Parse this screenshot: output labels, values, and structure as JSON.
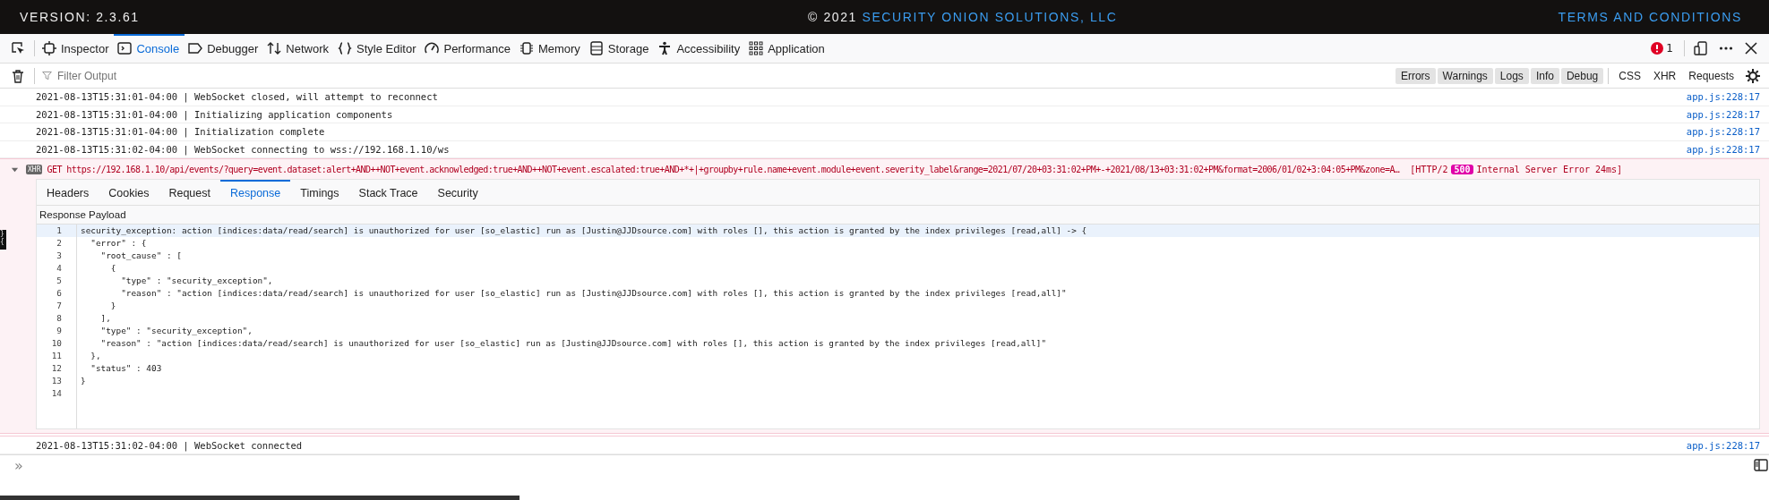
{
  "banner": {
    "version": "VERSION: 2.3.61",
    "copyright": "© 2021",
    "company": "SECURITY ONION SOLUTIONS, LLC",
    "terms": "TERMS AND CONDITIONS"
  },
  "tools": [
    {
      "label": "Inspector",
      "kind": "inspector",
      "selected": false
    },
    {
      "label": "Console",
      "kind": "console",
      "selected": true
    },
    {
      "label": "Debugger",
      "kind": "debugger",
      "selected": false
    },
    {
      "label": "Network",
      "kind": "network",
      "selected": false
    },
    {
      "label": "Style Editor",
      "kind": "style",
      "selected": false
    },
    {
      "label": "Performance",
      "kind": "performance",
      "selected": false
    },
    {
      "label": "Memory",
      "kind": "memory",
      "selected": false
    },
    {
      "label": "Storage",
      "kind": "storage",
      "selected": false
    },
    {
      "label": "Accessibility",
      "kind": "accessibility",
      "selected": false
    },
    {
      "label": "Application",
      "kind": "application",
      "selected": false
    }
  ],
  "error_count": "1",
  "filter": {
    "placeholder": "Filter Output"
  },
  "levels": [
    {
      "label": "Errors",
      "selected": true
    },
    {
      "label": "Warnings",
      "selected": true
    },
    {
      "label": "Logs",
      "selected": true
    },
    {
      "label": "Info",
      "selected": true
    },
    {
      "label": "Debug",
      "selected": true
    }
  ],
  "types": [
    {
      "label": "CSS",
      "selected": false
    },
    {
      "label": "XHR",
      "selected": false
    },
    {
      "label": "Requests",
      "selected": false
    }
  ],
  "messages": [
    {
      "text": "2021-08-13T15:31:01-04:00 | WebSocket closed, will attempt to reconnect",
      "source": "app.js:228:17"
    },
    {
      "text": "2021-08-13T15:31:01-04:00 | Initializing application components",
      "source": "app.js:228:17"
    },
    {
      "text": "2021-08-13T15:31:01-04:00 | Initialization complete",
      "source": "app.js:228:17"
    },
    {
      "text": "2021-08-13T15:31:02-04:00 | WebSocket connecting to wss://192.168.1.10/ws",
      "source": "app.js:228:17"
    }
  ],
  "request": {
    "expanded": true,
    "badge": "XHR",
    "method": "GET",
    "url": "https://192.168.1.10/api/events/?query=event.dataset:alert+AND++NOT+event.acknowledged:true+AND++NOT+event.escalated:true+AND+*+|+groupby+rule.name+event.module+event.severity_label&range=2021/07/20+03:31:02+PM+-+2021/08/13+03:31:02+PM&format=2006/01/02+3:04:05+PM&zone=A…",
    "protocol": "[HTTP/2",
    "status": "500",
    "status_text": "Internal Server Error 24ms]",
    "tabs": [
      {
        "label": "Headers",
        "selected": false
      },
      {
        "label": "Cookies",
        "selected": false
      },
      {
        "label": "Request",
        "selected": false
      },
      {
        "label": "Response",
        "selected": true
      },
      {
        "label": "Timings",
        "selected": false
      },
      {
        "label": "Stack Trace",
        "selected": false
      },
      {
        "label": "Security",
        "selected": false
      }
    ],
    "section": "Response Payload",
    "lines": [
      {
        "number": "1",
        "text": "security_exception: action [indices:data/read/search] is unauthorized for user [so_elastic] run as [Justin@JJDsource.com] with roles [], this action is granted by the index privileges [read,all] -> {",
        "selected": true
      },
      {
        "number": "2",
        "text": "  \"error\" : {",
        "selected": false
      },
      {
        "number": "3",
        "text": "    \"root_cause\" : [",
        "selected": false
      },
      {
        "number": "4",
        "text": "      {",
        "selected": false
      },
      {
        "number": "5",
        "text": "        \"type\" : \"security_exception\",",
        "selected": false
      },
      {
        "number": "6",
        "text": "        \"reason\" : \"action [indices:data/read/search] is unauthorized for user [so_elastic] run as [Justin@JJDsource.com] with roles [], this action is granted by the index privileges [read,all]\"",
        "selected": false
      },
      {
        "number": "7",
        "text": "      }",
        "selected": false
      },
      {
        "number": "8",
        "text": "    ],",
        "selected": false
      },
      {
        "number": "9",
        "text": "    \"type\" : \"security_exception\",",
        "selected": false
      },
      {
        "number": "10",
        "text": "    \"reason\" : \"action [indices:data/read/search] is unauthorized for user [so_elastic] run as [Justin@JJDsource.com] with roles [], this action is granted by the index privileges [read,all]\"",
        "selected": false
      },
      {
        "number": "11",
        "text": "  },",
        "selected": false
      },
      {
        "number": "12",
        "text": "  \"status\" : 403",
        "selected": false
      },
      {
        "number": "13",
        "text": "}",
        "selected": false
      },
      {
        "number": "14",
        "selected": false
      }
    ]
  },
  "last_message": {
    "text": "2021-08-13T15:31:02-04:00 | WebSocket connected",
    "source": "app.js:228:17"
  },
  "prompt": "»",
  "left_edge": [
    "}",
    "{"
  ]
}
